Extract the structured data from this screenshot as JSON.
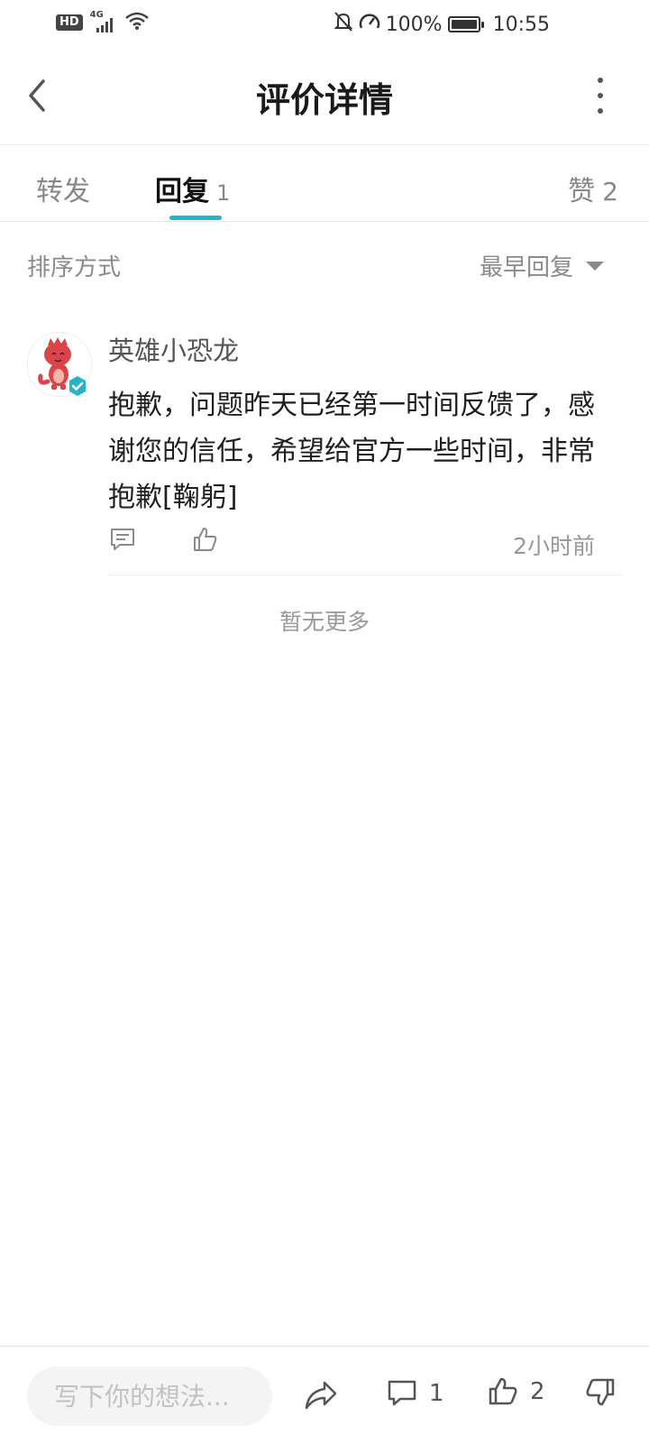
{
  "status_bar": {
    "hd": "HD",
    "network": "4G",
    "battery": "100%",
    "time": "10:55"
  },
  "header": {
    "title": "评价详情"
  },
  "tabs": [
    {
      "label": "转发",
      "count": ""
    },
    {
      "label": "回复",
      "count": "1"
    },
    {
      "label": "赞",
      "count": "2"
    }
  ],
  "sort": {
    "label": "排序方式",
    "selected": "最早回复"
  },
  "comment": {
    "author": "英雄小恐龙",
    "text": "抱歉，问题昨天已经第一时间反馈了，感谢您的信任，希望给官方一些时间，非常抱歉[鞠躬]",
    "time": "2小时前"
  },
  "no_more": "暂无更多",
  "bottom_bar": {
    "placeholder": "写下你的想法...",
    "comment_count": "1",
    "like_count": "2"
  },
  "colors": {
    "accent": "#23b6c7",
    "avatar_dino": "#d9454b"
  }
}
